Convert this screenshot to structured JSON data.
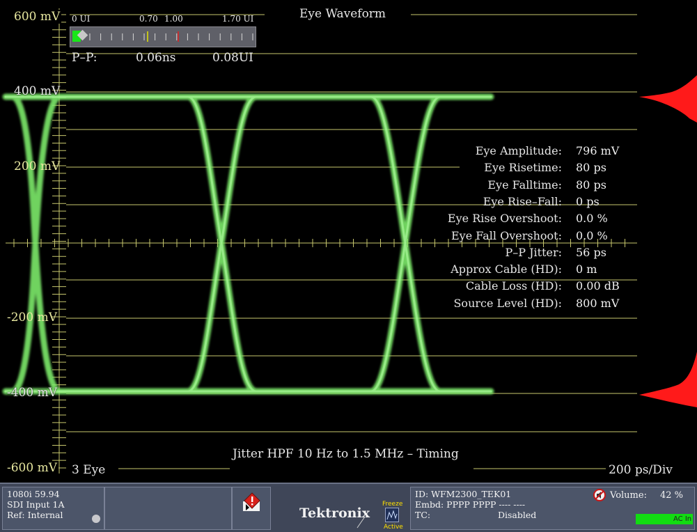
{
  "scope": {
    "title": "Eye Waveform",
    "y_labels": [
      "600 mV",
      "400 mV",
      "200 mV",
      "-200 mV",
      "-400 mV",
      "-600 mV"
    ],
    "bottom_left": "3 Eye",
    "bottom_right": "200 ps/Div",
    "jitter_caption": "Jitter HPF 10 Hz to 1.5 MHz – Timing",
    "pp": {
      "ticks": [
        "0 UI",
        "0.70",
        "1.00",
        "1.70 UI"
      ],
      "label": "P–P:",
      "ns": "0.06ns",
      "ui": "0.08UI"
    },
    "readouts": [
      {
        "label": "Eye Amplitude:",
        "value": "796 mV"
      },
      {
        "label": "Eye Risetime:",
        "value": "80 ps"
      },
      {
        "label": "Eye Falltime:",
        "value": "80 ps"
      },
      {
        "label": "Eye Rise–Fall:",
        "value": "0 ps"
      },
      {
        "label": "Eye Rise Overshoot:",
        "value": "0.0 %"
      },
      {
        "label": "Eye Fall Overshoot:",
        "value": "0.0 %"
      },
      {
        "label": "P–P Jitter:",
        "value": "56 ps"
      },
      {
        "label": "Approx Cable (HD):",
        "value": "0 m"
      },
      {
        "label": "Cable Loss (HD):",
        "value": "0.00 dB"
      },
      {
        "label": "Source Level (HD):",
        "value": "800 mV"
      }
    ],
    "colors": {
      "trace": "#7dea6a",
      "graticule": "#c8c86e",
      "histogram": "#ff1a1a"
    }
  },
  "status": {
    "format": "1080i 59.94",
    "input": "SDI Input 1A",
    "ref": "Ref: Internal",
    "alarm_icon": "alert-diamond-icon",
    "brand": "Tektronix",
    "freeze_top": "Freeze",
    "freeze_bottom": "Active",
    "id": "ID: WFM2300_TEK01",
    "embd": "Embd: PPPP PPPP ---- ----",
    "tc_label": "TC:",
    "tc_value": "Disabled",
    "volume_label": "Volume:",
    "volume_value": "42 %",
    "ac_label": "AC In"
  }
}
